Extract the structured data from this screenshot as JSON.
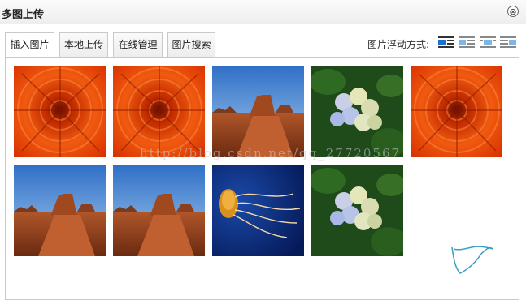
{
  "dialog": {
    "title": "多图上传",
    "close_label": "⊗"
  },
  "tabs": [
    {
      "label": "插入图片"
    },
    {
      "label": "本地上传"
    },
    {
      "label": "在线管理"
    },
    {
      "label": "图片搜索"
    }
  ],
  "float_options": {
    "label": "图片浮动方式:",
    "icons": [
      "align-none-icon",
      "align-left-icon",
      "align-center-icon",
      "align-right-icon"
    ],
    "selected_color": "#1a6fd0"
  },
  "images": [
    {
      "subject": "chrysanthemum"
    },
    {
      "subject": "chrysanthemum"
    },
    {
      "subject": "desert"
    },
    {
      "subject": "hydrangeas"
    },
    {
      "subject": "chrysanthemum"
    },
    {
      "subject": "desert"
    },
    {
      "subject": "desert"
    },
    {
      "subject": "jellyfish"
    },
    {
      "subject": "hydrangeas"
    }
  ],
  "watermark": "http://blog.csdn.net/qq_27720567"
}
